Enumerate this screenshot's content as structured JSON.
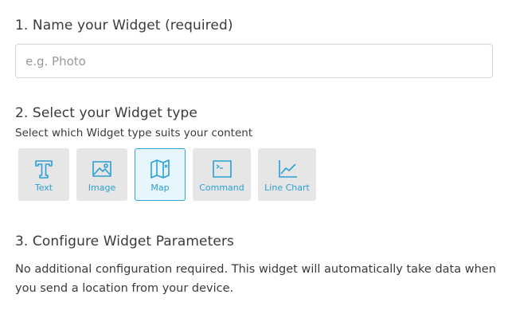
{
  "section1": {
    "title": "1. Name your Widget (required)",
    "input_placeholder": "e.g. Photo",
    "input_value": ""
  },
  "section2": {
    "title": "2. Select your Widget type",
    "subtitle": "Select which Widget type suits your content",
    "selected": "Map",
    "types": [
      {
        "label": "Text",
        "icon": "text-icon"
      },
      {
        "label": "Image",
        "icon": "image-icon"
      },
      {
        "label": "Map",
        "icon": "map-icon"
      },
      {
        "label": "Command",
        "icon": "terminal-icon"
      },
      {
        "label": "Line Chart",
        "icon": "line-chart-icon"
      }
    ]
  },
  "section3": {
    "title": "3. Configure Widget Parameters",
    "description": "No additional configuration required. This widget will automatically take data when you send a location from your device."
  },
  "colors": {
    "accent": "#2a9fd6",
    "tile_background": "#e6e6e6",
    "selected_background": "#e6f6fc",
    "selected_border": "#2aa7dc",
    "text": "#3a3a3a"
  }
}
